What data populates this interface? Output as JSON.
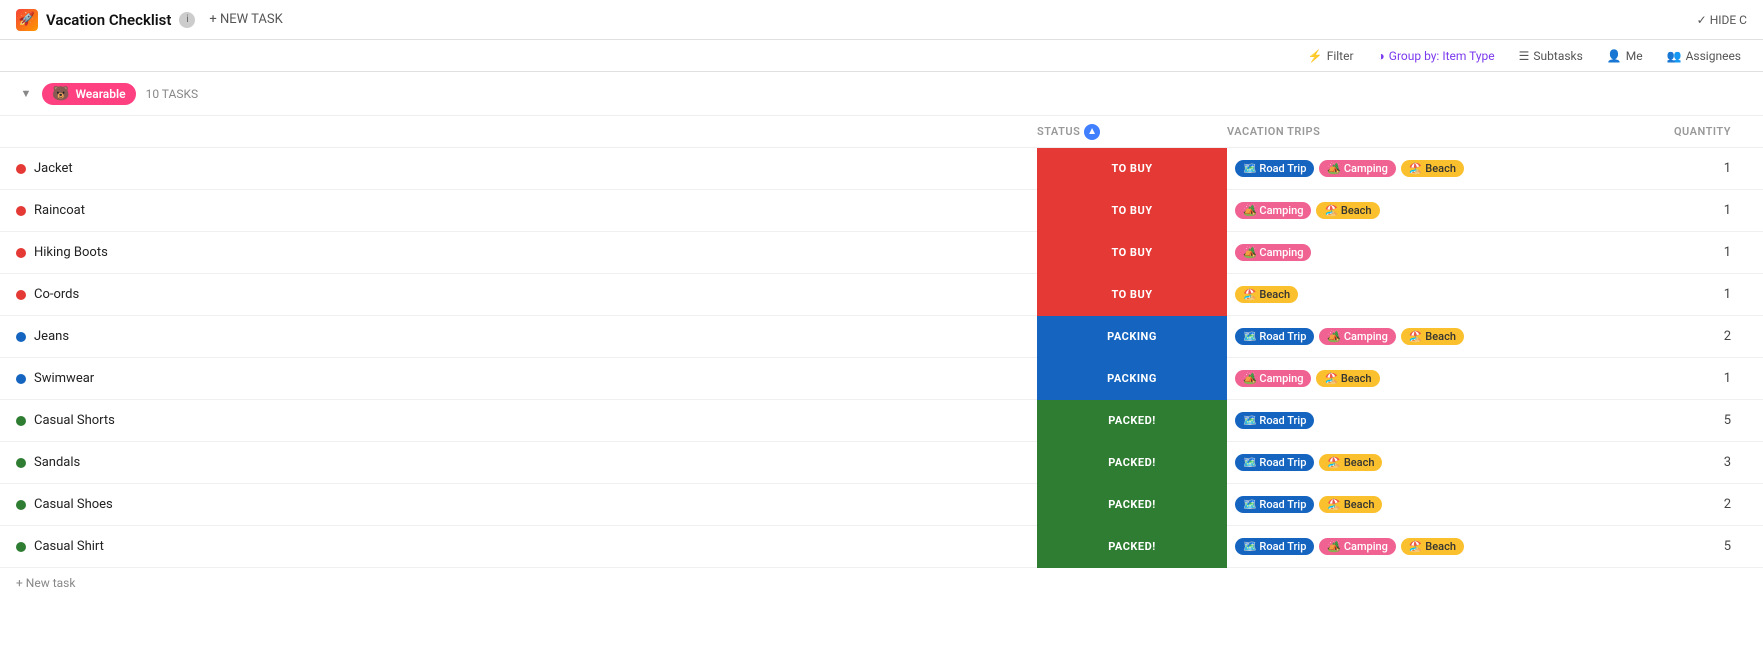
{
  "header": {
    "logo": "🚀",
    "title": "Vacation Checklist",
    "new_task_label": "+ NEW TASK",
    "hide_label": "✓ HIDE C"
  },
  "toolbar": {
    "filter_label": "Filter",
    "group_by_label": "Group by: Item Type",
    "subtasks_label": "Subtasks",
    "me_label": "Me",
    "assignees_label": "Assignees"
  },
  "group": {
    "emoji": "🐻",
    "name": "Wearable",
    "task_count": "10 TASKS",
    "collapse_icon": "▼"
  },
  "columns": {
    "task_name": "",
    "status": "STATUS",
    "vacation_trips": "VACATION TRIPS",
    "quantity": "QUANTITY"
  },
  "tasks": [
    {
      "name": "Jacket",
      "color": "#e53935",
      "status": "TO BUY",
      "status_class": "status-to-buy",
      "trips": [
        {
          "label": "🗺️ Road Trip",
          "class": "trip-road"
        },
        {
          "label": "🏕️ Camping",
          "class": "trip-camping"
        },
        {
          "label": "🏖️ Beach",
          "class": "trip-beach"
        }
      ],
      "quantity": 1
    },
    {
      "name": "Raincoat",
      "color": "#e53935",
      "status": "TO BUY",
      "status_class": "status-to-buy",
      "trips": [
        {
          "label": "🏕️ Camping",
          "class": "trip-camping"
        },
        {
          "label": "🏖️ Beach",
          "class": "trip-beach"
        }
      ],
      "quantity": 1
    },
    {
      "name": "Hiking Boots",
      "color": "#e53935",
      "status": "TO BUY",
      "status_class": "status-to-buy",
      "trips": [
        {
          "label": "🏕️ Camping",
          "class": "trip-camping"
        }
      ],
      "quantity": 1
    },
    {
      "name": "Co-ords",
      "color": "#e53935",
      "status": "TO BUY",
      "status_class": "status-to-buy",
      "trips": [
        {
          "label": "🏖️ Beach",
          "class": "trip-beach"
        }
      ],
      "quantity": 1
    },
    {
      "name": "Jeans",
      "color": "#1565c0",
      "status": "PACKING",
      "status_class": "status-packing",
      "trips": [
        {
          "label": "🗺️ Road Trip",
          "class": "trip-road"
        },
        {
          "label": "🏕️ Camping",
          "class": "trip-camping"
        },
        {
          "label": "🏖️ Beach",
          "class": "trip-beach"
        }
      ],
      "quantity": 2
    },
    {
      "name": "Swimwear",
      "color": "#1565c0",
      "status": "PACKING",
      "status_class": "status-packing",
      "trips": [
        {
          "label": "🏕️ Camping",
          "class": "trip-camping"
        },
        {
          "label": "🏖️ Beach",
          "class": "trip-beach"
        }
      ],
      "quantity": 1
    },
    {
      "name": "Casual Shorts",
      "color": "#2e7d32",
      "status": "PACKED!",
      "status_class": "status-packed",
      "trips": [
        {
          "label": "🗺️ Road Trip",
          "class": "trip-road"
        }
      ],
      "quantity": 5
    },
    {
      "name": "Sandals",
      "color": "#2e7d32",
      "status": "PACKED!",
      "status_class": "status-packed",
      "trips": [
        {
          "label": "🗺️ Road Trip",
          "class": "trip-road"
        },
        {
          "label": "🏖️ Beach",
          "class": "trip-beach"
        }
      ],
      "quantity": 3
    },
    {
      "name": "Casual Shoes",
      "color": "#2e7d32",
      "status": "PACKED!",
      "status_class": "status-packed",
      "trips": [
        {
          "label": "🗺️ Road Trip",
          "class": "trip-road"
        },
        {
          "label": "🏖️ Beach",
          "class": "trip-beach"
        }
      ],
      "quantity": 2
    },
    {
      "name": "Casual Shirt",
      "color": "#2e7d32",
      "status": "PACKED!",
      "status_class": "status-packed",
      "trips": [
        {
          "label": "🗺️ Road Trip",
          "class": "trip-road"
        },
        {
          "label": "🏕️ Camping",
          "class": "trip-camping"
        },
        {
          "label": "🏖️ Beach",
          "class": "trip-beach"
        }
      ],
      "quantity": 5
    }
  ],
  "add_task_label": "+ New task"
}
